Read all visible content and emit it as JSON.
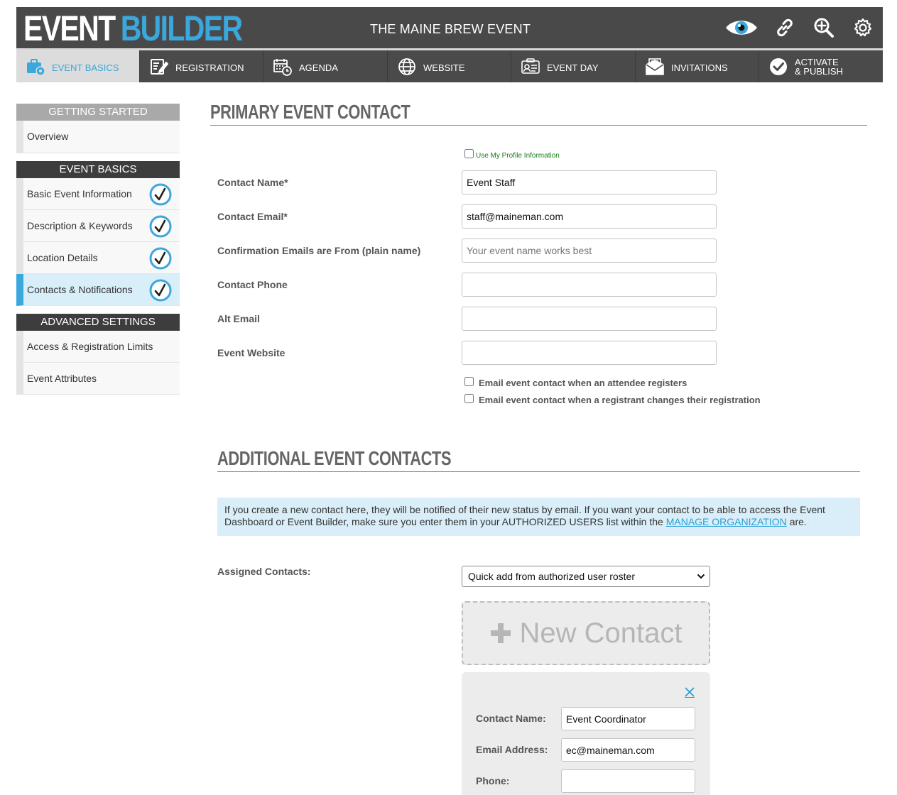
{
  "header": {
    "logo_word1": "EVENT",
    "logo_word2": "BUILDER",
    "event_title": "THE MAINE BREW EVENT",
    "icons": [
      "eye-icon",
      "link-icon",
      "zoom-in-icon",
      "gear-icon"
    ]
  },
  "nav": {
    "items": [
      {
        "label": "EVENT BASICS",
        "icon": "briefcase-gear-icon",
        "active": true
      },
      {
        "label": "REGISTRATION",
        "icon": "edit-form-icon"
      },
      {
        "label": "AGENDA",
        "icon": "calendar-clock-icon"
      },
      {
        "label": "WEBSITE",
        "icon": "globe-icon"
      },
      {
        "label": "EVENT DAY",
        "icon": "badge-icon"
      },
      {
        "label": "INVITATIONS",
        "icon": "envelope-icon"
      },
      {
        "label_line1": "ACTIVATE",
        "label_line2": "& PUBLISH",
        "icon": "check-circle-icon"
      }
    ]
  },
  "sidebar": {
    "getting_started": {
      "title": "GETTING STARTED",
      "items": [
        {
          "label": "Overview"
        }
      ]
    },
    "event_basics": {
      "title": "EVENT BASICS",
      "items": [
        {
          "label": "Basic Event Information",
          "complete": true
        },
        {
          "label": "Description & Keywords",
          "complete": true
        },
        {
          "label": "Location Details",
          "complete": true
        },
        {
          "label": "Contacts & Notifications",
          "complete": true,
          "active": true
        }
      ]
    },
    "advanced": {
      "title": "ADVANCED SETTINGS",
      "items": [
        {
          "label": "Access & Registration Limits"
        },
        {
          "label": "Event Attributes"
        }
      ]
    }
  },
  "primary": {
    "title": "PRIMARY EVENT CONTACT",
    "use_profile_label": "Use My Profile Information",
    "fields": {
      "contact_name": {
        "label": "Contact Name*",
        "value": "Event Staff"
      },
      "contact_email": {
        "label": "Contact Email*",
        "value": "staff@maineman.com"
      },
      "confirm_from": {
        "label": "Confirmation Emails are From (plain name)",
        "placeholder": "Your event name works best"
      },
      "contact_phone": {
        "label": "Contact Phone",
        "value": ""
      },
      "alt_email": {
        "label": "Alt Email",
        "value": ""
      },
      "event_website": {
        "label": "Event Website",
        "value": ""
      }
    },
    "notify_register_label": "Email event contact when an attendee registers",
    "notify_change_label": "Email event contact when a registrant changes their registration"
  },
  "additional": {
    "title": "ADDITIONAL EVENT CONTACTS",
    "info_text": "If you create a new contact here, they will be notified of their new status by email. If you want your contact to be able to access the Event Dashboard or Event Builder, make sure you enter them in your AUTHORIZED USERS list within the",
    "info_link": "MANAGE ORGANIZATION",
    "info_tail": "are.",
    "assigned_label": "Assigned Contacts:",
    "select_value": "Quick add from authorized user roster",
    "new_contact_label": "New Contact",
    "card": {
      "name_label": "Contact Name:",
      "name_value": "Event Coordinator",
      "email_label": "Email Address:",
      "email_value": "ec@maineman.com",
      "phone_label": "Phone:",
      "phone_value": ""
    }
  },
  "colors": {
    "accent": "#3aa7dd",
    "header_bg": "#494949",
    "sidebar_active": "#d8eef9",
    "info_bg": "#d9eef8"
  }
}
